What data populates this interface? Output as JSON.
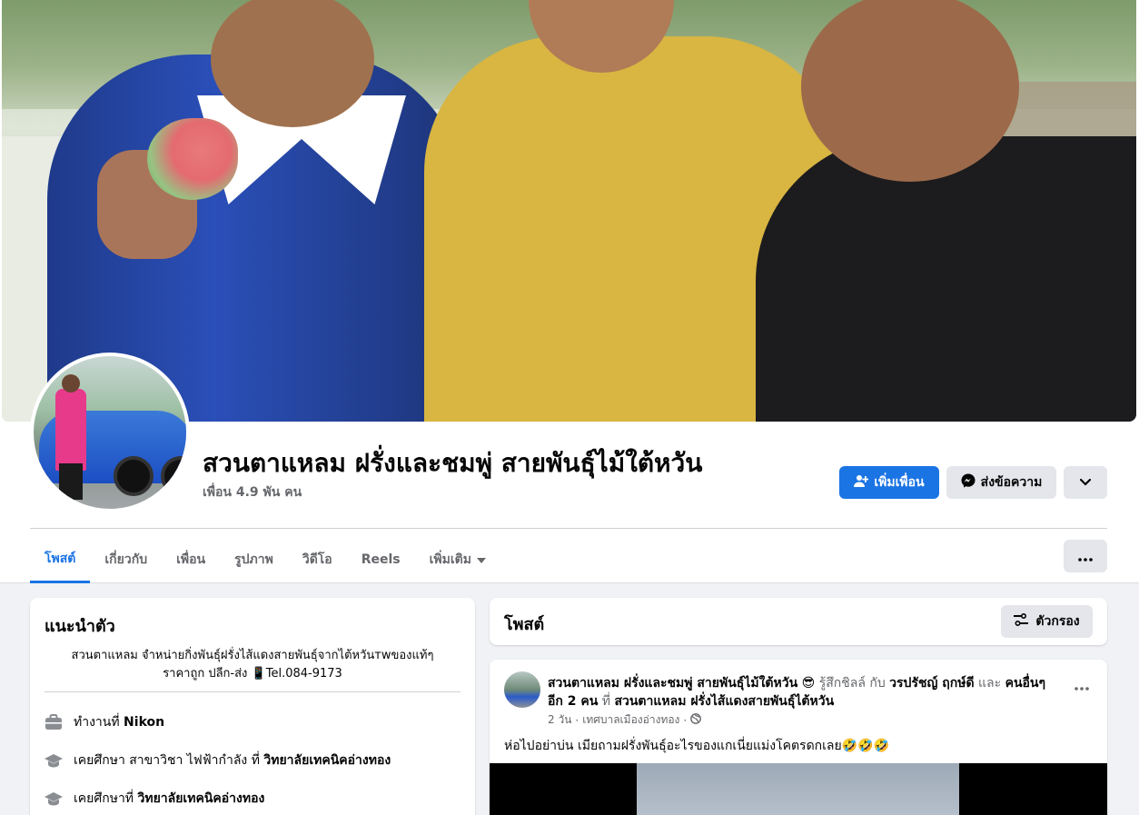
{
  "profile": {
    "name": "สวนตาแหลม ฝรั่งและชมพู่ สายพันธุ์ไม้ใต้หวัน",
    "friends": "เพื่อน 4.9 พัน คน"
  },
  "actions": {
    "add_friend": "เพิ่มเพื่อน",
    "message": "ส่งข้อความ"
  },
  "tabs": [
    {
      "label": "โพสต์"
    },
    {
      "label": "เกี่ยวกับ"
    },
    {
      "label": "เพื่อน"
    },
    {
      "label": "รูปภาพ"
    },
    {
      "label": "วิดีโอ"
    },
    {
      "label": "Reels"
    },
    {
      "label": "เพิ่มเติม"
    }
  ],
  "intro": {
    "title": "แนะนำตัว",
    "bio_line1": "สวนตาแหลม จำหน่ายกิ่งพันธุ์ฝรั่งไส้แดงสายพันธุ์จากไต้หวันтwของแท้ๆ",
    "bio_line2": "ราคาถูก ปลีก-ส่ง 📱Tel.084-9173",
    "work": {
      "prefix": "ทำงานที่",
      "place": "Nikon"
    },
    "edu1": {
      "prefix": "เคยศึกษา สาขาวิชา ไฟฟ้ากำลัง ที่",
      "place": "วิทยาลัยเทคนิคอ่างทอง"
    },
    "edu2": {
      "prefix": "เคยศึกษาที่",
      "place": "วิทยาลัยเทคนิคอ่างทอง"
    }
  },
  "posts": {
    "title": "โพสต์",
    "filter": "ตัวกรอง"
  },
  "post": {
    "author": "สวนตาแหลม ฝรั่งและชมพู่ สายพันธุ์ไม้ใต้หวัน",
    "feeling": "รู้สึกชิลล์ กับ",
    "tagged": "วรปรัชญ์ ฤกษ์ดี",
    "and": "และ",
    "others": "คนอื่นๆ อีก 2 คน",
    "at": "ที่",
    "place": "สวนตาแหลม ฝรั่งไส้แดงสายพันธุ์ไต้หวัน",
    "time": "2 วัน",
    "location": "เทศบาลเมืองอ่างทอง",
    "text": "ห่อไปอย่าบ่น เมียถามฝรั่งพันธุ์อะไรของแกเนี่ยแม่งโคตรดกเลย🤣🤣🤣"
  },
  "colors": {
    "accent": "#1b74e4",
    "bg": "#f0f2f5",
    "muted": "#65676b"
  }
}
